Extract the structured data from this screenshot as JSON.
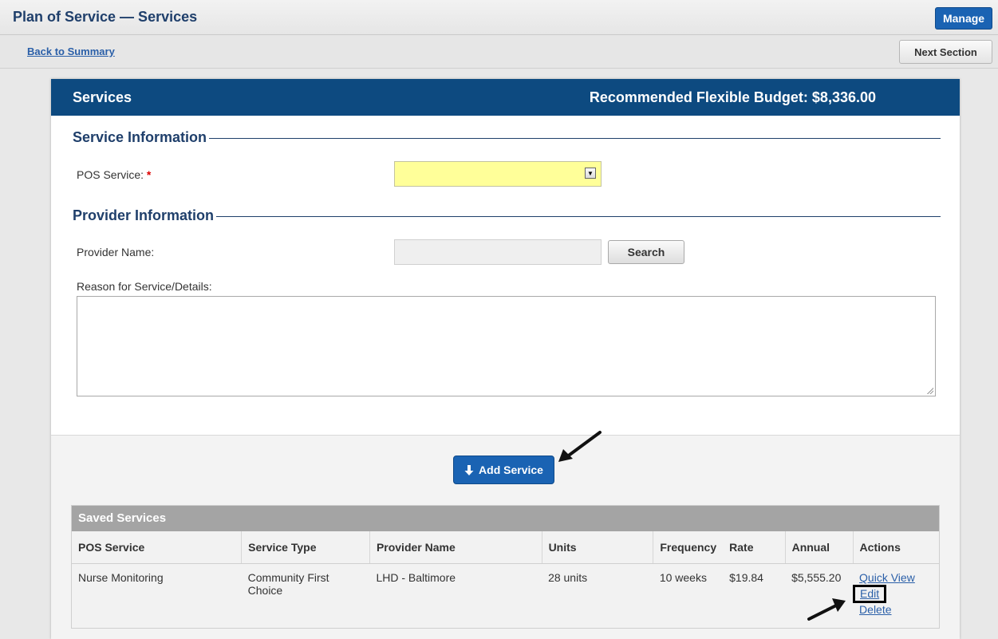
{
  "header": {
    "title": "Plan of Service — Services",
    "manage_label": "Manage"
  },
  "subbar": {
    "back_label": "Back to Summary",
    "next_label": "Next Section"
  },
  "panel": {
    "title": "Services",
    "budget": "Recommended Flexible Budget: $8,336.00"
  },
  "service_info": {
    "heading": "Service Information",
    "pos_label": "POS Service:",
    "required_mark": "*",
    "pos_value": ""
  },
  "provider_info": {
    "heading": "Provider Information",
    "name_label": "Provider Name:",
    "name_value": "",
    "search_label": "Search",
    "reason_label": "Reason for Service/Details:",
    "reason_value": ""
  },
  "add_service": {
    "label": "Add Service",
    "icon": "arrow-down-icon"
  },
  "saved_services": {
    "title": "Saved Services",
    "columns": [
      "POS Service",
      "Service Type",
      "Provider Name",
      "Units",
      "Frequency",
      "Rate",
      "Annual",
      "Actions"
    ],
    "rows": [
      {
        "pos_service": "Nurse Monitoring",
        "service_type": "Community First Choice",
        "provider_name": "LHD - Baltimore",
        "units": "28 units",
        "frequency": "10 weeks",
        "rate": "$19.84",
        "annual": "$5,555.20",
        "actions": [
          "Quick View",
          "Edit",
          "Delete"
        ]
      }
    ]
  },
  "colors": {
    "brand_blue": "#0d4a80",
    "button_blue": "#1a63b3",
    "required_highlight": "#ffff99"
  }
}
